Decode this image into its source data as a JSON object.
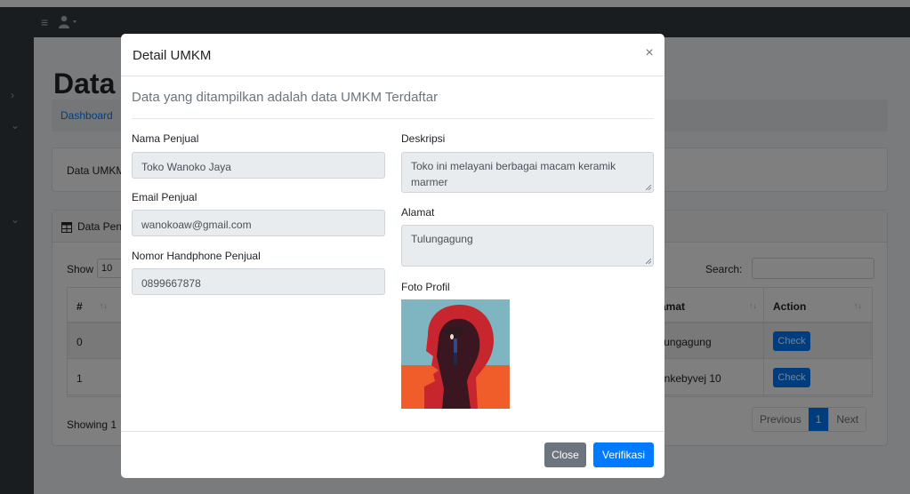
{
  "background": {
    "page_title": "Data UMKM",
    "breadcrumb": "Dashboard",
    "info_text": "Data UMKM",
    "card_title": "Data Penjual",
    "show_label": "Show",
    "show_value": "10",
    "search_label": "Search:",
    "table": {
      "headers": [
        "#",
        "Alamat",
        "Action"
      ],
      "rows": [
        {
          "index": "0",
          "alamat": "Tulungagung",
          "action": "Check"
        },
        {
          "index": "1",
          "alamat": "Mankebyvej 10",
          "action": "Check"
        }
      ]
    },
    "showing": "Showing 1",
    "pagination": {
      "previous": "Previous",
      "current": "1",
      "next": "Next"
    }
  },
  "modal": {
    "title": "Detail UMKM",
    "close_symbol": "×",
    "lead": "Data yang ditampilkan adalah data UMKM Terdaftar",
    "fields": {
      "nama_label": "Nama Penjual",
      "nama_value": "Toko Wanoko Jaya",
      "email_label": "Email Penjual",
      "email_value": "wanokoaw@gmail.com",
      "phone_label": "Nomor Handphone Penjual",
      "phone_value": "0899667878",
      "deskripsi_label": "Deskripsi",
      "deskripsi_value": "Toko ini melayani berbagai macam keramik marmer",
      "alamat_label": "Alamat",
      "alamat_value": "Tulungagung",
      "foto_label": "Foto Profil"
    },
    "buttons": {
      "close": "Close",
      "verify": "Verifikasi"
    }
  },
  "icons": {
    "menu": "menu-icon",
    "user": "user-icon",
    "table": "table-icon",
    "sort": "sort-icon",
    "close": "close-icon"
  },
  "colors": {
    "primary": "#007bff",
    "secondary": "#6c757d",
    "topbar": "#343a40",
    "content_bg": "#f4f6f9"
  }
}
